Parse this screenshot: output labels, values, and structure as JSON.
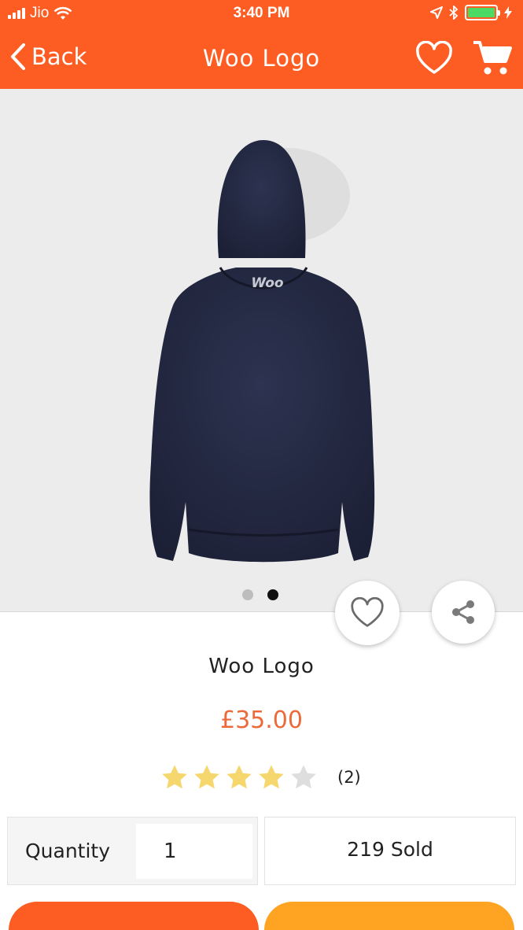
{
  "status_bar": {
    "carrier": "Jio",
    "time": "3:40 PM"
  },
  "nav": {
    "back_label": "Back",
    "title": "Woo Logo"
  },
  "product": {
    "image_logo_text": "Woo",
    "name": "Woo Logo",
    "price": "£35.00",
    "rating": 4,
    "rating_max": 5,
    "review_count": "(2)",
    "quantity_label": "Quantity",
    "quantity_value": "1",
    "sold": "219 Sold"
  },
  "carousel": {
    "total": 2,
    "active_index": 1
  },
  "colors": {
    "brand": "#fd5d22",
    "secondary": "#ffa422",
    "price": "#ec6a3a",
    "star": "#f5d76e"
  },
  "icons": [
    "back-chevron-icon",
    "heart-icon",
    "cart-icon",
    "share-icon",
    "star-icon"
  ]
}
